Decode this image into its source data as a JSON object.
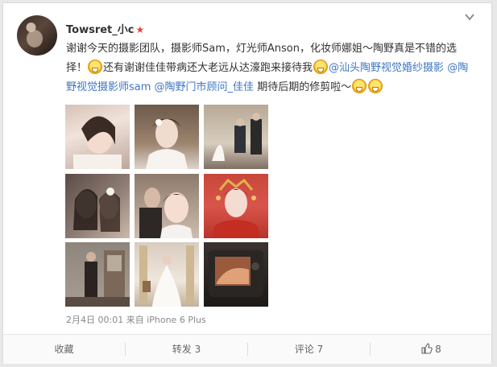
{
  "post": {
    "author": "Towsret_小c",
    "verified_mark": "★",
    "text_before_emoji1": "谢谢今天的摄影团队，摄影师Sam，灯光师Anson，化妆师娜姐～陶野真是不错的选择！",
    "text_after_emoji1": "还有谢谢佳佳带病还大老远从达濠跑来接待我",
    "mention_1": "@汕头陶野视觉婚纱摄影",
    "mention_2": "@陶野视觉摄影师sam",
    "mention_3": "@陶野门市顾问_佳佳",
    "text_tail": " 期待后期的修剪啦～",
    "timestamp": "2月4日 00:01",
    "source": "来自 iPhone 6 Plus"
  },
  "actions": {
    "favorite": "收藏",
    "repost": "转发 3",
    "comment": "评论 7",
    "like": "8"
  },
  "icons": {
    "menu": "chevron-down-icon",
    "like": "thumbs-up-icon",
    "emoji": "grin-emoji-icon"
  },
  "colors": {
    "link": "#3f76c1",
    "verified": "#e5462b"
  }
}
